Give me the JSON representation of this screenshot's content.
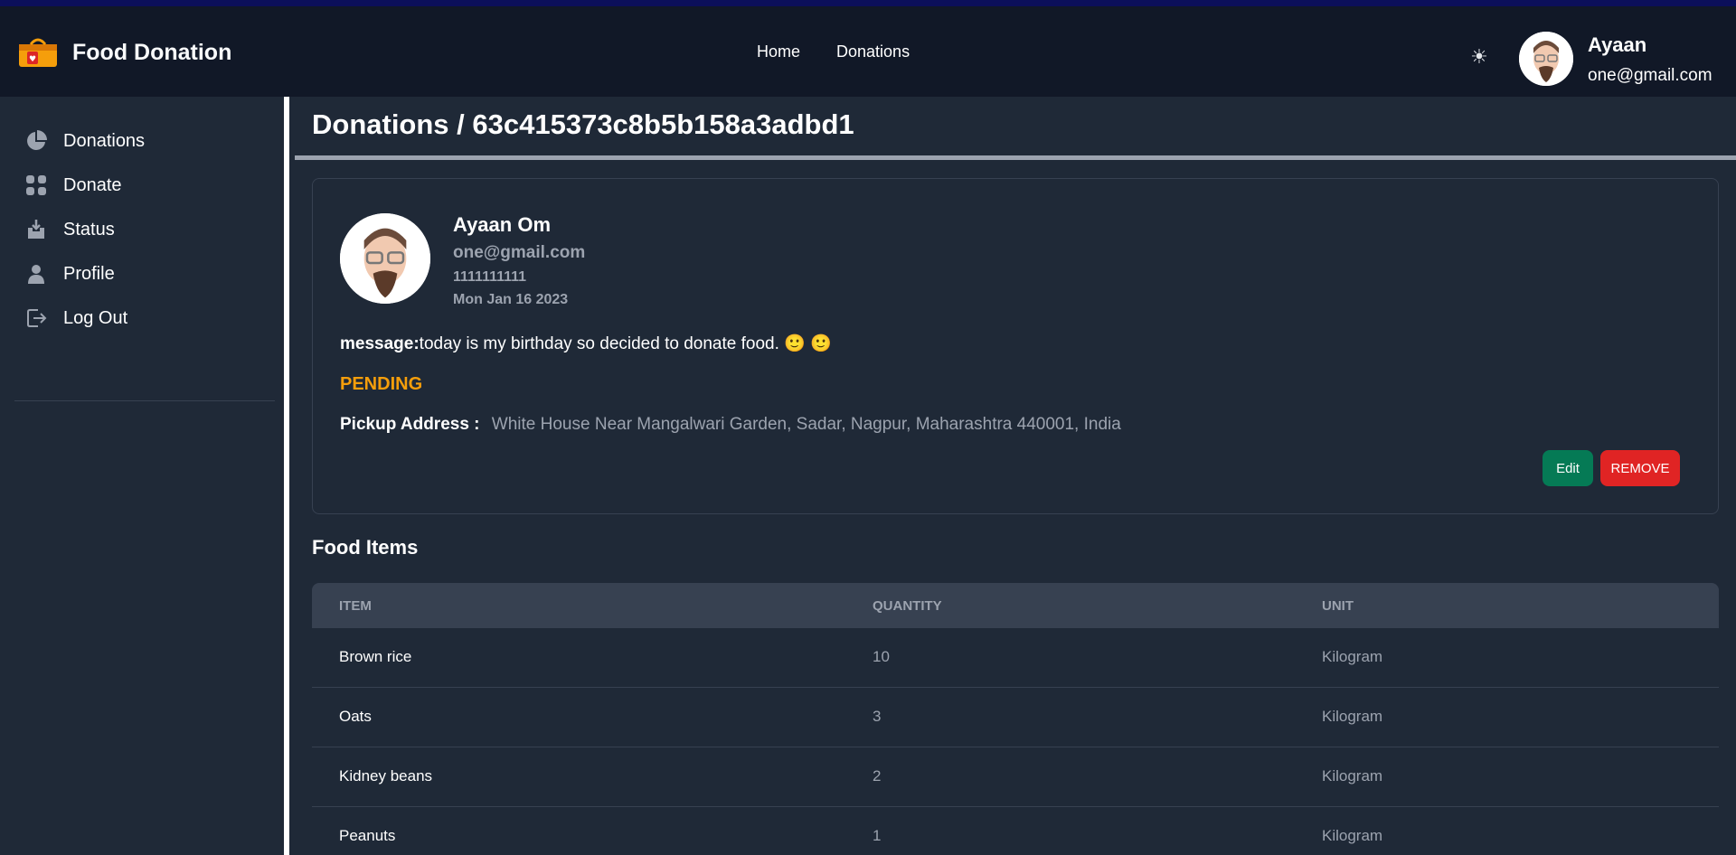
{
  "navbar": {
    "brand": "Food Donation",
    "links": [
      "Home",
      "Donations"
    ],
    "theme_icon": "sun-icon",
    "user": {
      "name": "Ayaan",
      "email": "one@gmail.com"
    }
  },
  "sidebar": {
    "items": [
      {
        "label": "Donations",
        "icon": "pie-chart-icon"
      },
      {
        "label": "Donate",
        "icon": "grid-icon"
      },
      {
        "label": "Status",
        "icon": "download-tray-icon"
      },
      {
        "label": "Profile",
        "icon": "user-icon"
      },
      {
        "label": "Log Out",
        "icon": "logout-icon"
      }
    ]
  },
  "page": {
    "breadcrumb": "Donations / 63c415373c8b5b158a3adbd1"
  },
  "donation": {
    "donor_name": "Ayaan Om",
    "email": "one@gmail.com",
    "phone": "1111111111",
    "date": "Mon Jan 16 2023",
    "message_label": "message:",
    "message": "today is my birthday so decided to donate food. 🙂 🙂",
    "status": "PENDING",
    "status_color": "#f59e0b",
    "pickup_label": "Pickup Address :",
    "pickup_address": "White House Near Mangalwari Garden, Sadar, Nagpur, Maharashtra 440001, India",
    "edit_label": "Edit",
    "remove_label": "REMOVE"
  },
  "food": {
    "title": "Food Items",
    "columns": [
      "ITEM",
      "QUANTITY",
      "UNIT"
    ],
    "rows": [
      {
        "item": "Brown rice",
        "quantity": "10",
        "unit": "Kilogram"
      },
      {
        "item": "Oats",
        "quantity": "3",
        "unit": "Kilogram"
      },
      {
        "item": "Kidney beans",
        "quantity": "2",
        "unit": "Kilogram"
      },
      {
        "item": "Peanuts",
        "quantity": "1",
        "unit": "Kilogram"
      }
    ]
  },
  "colors": {
    "accent_green": "#057a55",
    "accent_red": "#e02424",
    "bg": "#1f2937",
    "nav_bg": "#111827"
  }
}
